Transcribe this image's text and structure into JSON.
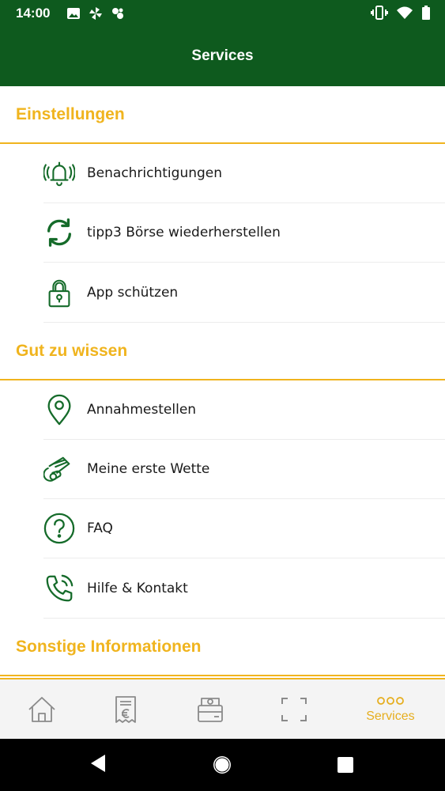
{
  "status_bar": {
    "time": "14:00",
    "left_icons": [
      "image-icon",
      "pinwheel-icon",
      "game-icon"
    ],
    "right_icons": [
      "vibrate-icon",
      "wifi-icon",
      "battery-icon"
    ]
  },
  "header": {
    "title": "Services"
  },
  "sections": [
    {
      "title": "Einstellungen",
      "items": [
        {
          "label": "Benachrichtigungen",
          "icon": "bell-icon"
        },
        {
          "label": "tipp3 Börse wiederherstellen",
          "icon": "refresh-icon"
        },
        {
          "label": "App schützen",
          "icon": "lock-icon"
        }
      ]
    },
    {
      "title": "Gut zu wissen",
      "items": [
        {
          "label": "Annahmestellen",
          "icon": "location-pin-icon"
        },
        {
          "label": "Meine erste Wette",
          "icon": "ticket-hand-icon"
        },
        {
          "label": "FAQ",
          "icon": "question-icon"
        },
        {
          "label": "Hilfe & Kontakt",
          "icon": "phone-icon"
        }
      ]
    },
    {
      "title": "Sonstige Informationen",
      "items": []
    }
  ],
  "bottom_nav": {
    "items": [
      {
        "icon": "home-icon",
        "label": ""
      },
      {
        "icon": "receipt-euro-icon",
        "label": ""
      },
      {
        "icon": "wallet-icon",
        "label": ""
      },
      {
        "icon": "scan-icon",
        "label": ""
      },
      {
        "icon": "more-dots-icon",
        "label": "Services",
        "active": true
      }
    ]
  },
  "colors": {
    "brand_green": "#0e5a1e",
    "accent_yellow": "#f0b41e",
    "icon_green": "#156b2a"
  }
}
